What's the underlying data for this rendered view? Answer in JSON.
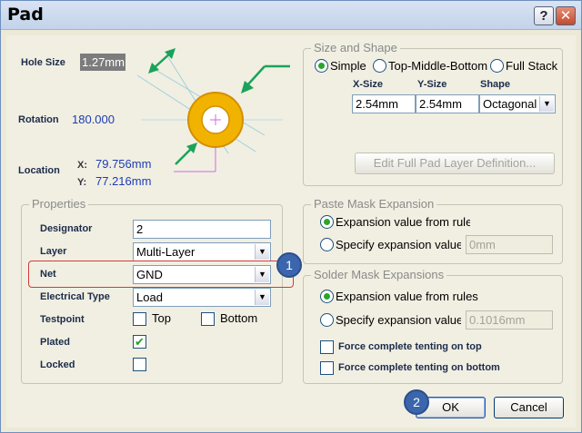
{
  "window": {
    "title": "Pad",
    "help_label": "?",
    "close_label": "X"
  },
  "pad_view": {
    "hole_size_label": "Hole Size",
    "hole_size_value": "1.27mm",
    "rotation_label": "Rotation",
    "rotation_value": "180.000",
    "location_label": "Location",
    "x_label": "X:",
    "x_value": "79.756mm",
    "y_label": "Y:",
    "y_value": "77.216mm"
  },
  "size_and_shape": {
    "title": "Size and Shape",
    "options": [
      "Simple",
      "Top-Middle-Bottom",
      "Full Stack"
    ],
    "selected_option": "Simple",
    "col_x": "X-Size",
    "col_y": "Y-Size",
    "col_shape": "Shape",
    "x_size": "2.54mm",
    "y_size": "2.54mm",
    "shape": "Octagonal",
    "edit_button": "Edit Full Pad Layer Definition..."
  },
  "properties": {
    "title": "Properties",
    "designator_label": "Designator",
    "designator_value": "2",
    "layer_label": "Layer",
    "layer_value": "Multi-Layer",
    "net_label": "Net",
    "net_value": "GND",
    "electrical_type_label": "Electrical Type",
    "electrical_type_value": "Load",
    "testpoint_label": "Testpoint",
    "top_label": "Top",
    "bottom_label": "Bottom",
    "plated_label": "Plated",
    "locked_label": "Locked",
    "plated_checked": true,
    "locked_checked": false,
    "top_checked": false,
    "bottom_checked": false
  },
  "paste_mask": {
    "title": "Paste Mask Expansion",
    "option_rules": "Expansion value from rules",
    "option_specify": "Specify expansion value",
    "value": "0mm"
  },
  "solder_mask": {
    "title": "Solder Mask Expansions",
    "option_rules": "Expansion value from rules",
    "option_specify": "Specify expansion value",
    "value": "0.1016mm",
    "tent_top": "Force complete tenting on top",
    "tent_bottom": "Force complete tenting on bottom"
  },
  "footer": {
    "ok": "OK",
    "cancel": "Cancel"
  },
  "callouts": {
    "one": "1",
    "two": "2"
  },
  "colors": {
    "pad_ring": "#f2b300",
    "highlight": "#d23a3a",
    "arrow": "#1aa35a",
    "badge": "#3b66ad"
  }
}
